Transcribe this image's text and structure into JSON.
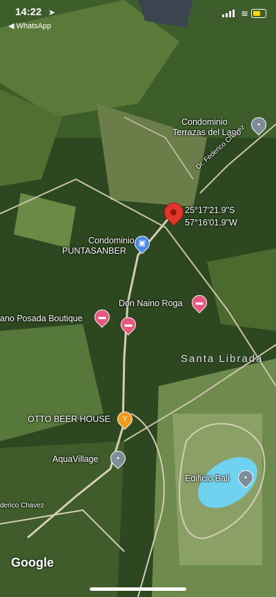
{
  "status_bar": {
    "time": "14:22",
    "back_label": "◀ WhatsApp"
  },
  "coordinates": {
    "lat": "25°17'21.9\"S",
    "lng": "57°16'01.9\"W"
  },
  "places": [
    {
      "label": "Condominio",
      "label2": "Terrazas del Lago",
      "icon": "gray-pin-icon"
    },
    {
      "label": "Condominio",
      "label2": "PUNTASANBER",
      "icon": "shopping-bag-icon"
    },
    {
      "label": "Don Naino Roga",
      "icon": "hotel-bed-icon"
    },
    {
      "label": "ano Posada Boutique",
      "icon": "hotel-bed-icon"
    },
    {
      "label": "OTTO BEER HOUSE",
      "icon": "cocktail-icon"
    },
    {
      "label": "AquaVillage",
      "icon": "gray-pin-icon"
    },
    {
      "label": "Edificio Bali",
      "icon": "gray-pin-icon"
    }
  ],
  "roads": {
    "upper": "Dr. Federico Chavez",
    "lower": "derico Chavez"
  },
  "area_label": "Santa Librada",
  "attribution": "Google",
  "colors": {
    "marker_red": "#e0362c",
    "hotel_pink": "#e8587c",
    "shop_blue": "#4e8ae8",
    "bar_orange": "#f29a1d",
    "place_gray": "#7f8d9a"
  }
}
